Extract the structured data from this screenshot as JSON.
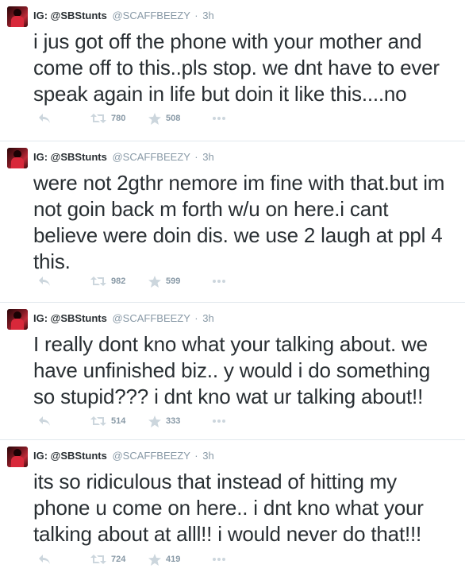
{
  "tweets": [
    {
      "name": "IG: @SBStunts",
      "handle": "@SCAFFBEEZY",
      "separator": "·",
      "time": "3h",
      "text": "i jus got off the phone with your mother and come off to this..pls stop. we dnt have to ever speak again in life but doin it like this....no",
      "retweets": "780",
      "favorites": "508"
    },
    {
      "name": "IG: @SBStunts",
      "handle": "@SCAFFBEEZY",
      "separator": "·",
      "time": "3h",
      "text": "were not 2gthr nemore im fine with that.but im not goin back m forth w/u on here.i cant believe were doin dis. we use 2 laugh at ppl 4 this.",
      "retweets": "982",
      "favorites": "599"
    },
    {
      "name": "IG: @SBStunts",
      "handle": "@SCAFFBEEZY",
      "separator": "·",
      "time": "3h",
      "text": "I really dont kno what your talking about. we have unfinished biz.. y would i do something so stupid??? i dnt kno wat ur talking about!!",
      "retweets": "514",
      "favorites": "333"
    },
    {
      "name": "IG: @SBStunts",
      "handle": "@SCAFFBEEZY",
      "separator": "·",
      "time": "3h",
      "text": "its so ridiculous that instead of hitting my phone u come on here.. i dnt kno what your talking about at alll!! i would never do that!!!",
      "retweets": "724",
      "favorites": "419"
    }
  ],
  "icons": {
    "reply": "reply-icon",
    "retweet": "retweet-icon",
    "favorite": "star-icon",
    "more": "more-icon"
  },
  "colors": {
    "text": "#292f33",
    "muted": "#8899a6",
    "icon": "#ccd6dd",
    "divider": "#e1e8ed"
  }
}
